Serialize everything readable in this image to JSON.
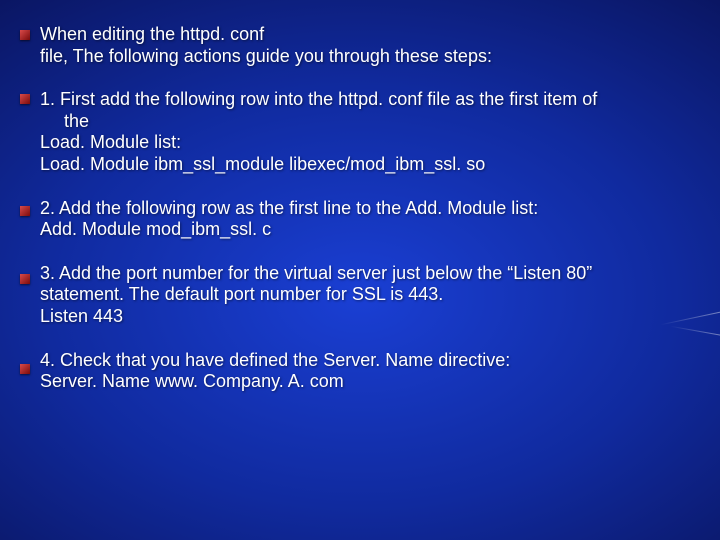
{
  "intro": {
    "line1": "When editing the httpd. conf",
    "line2": "file, The following actions guide you through these steps:"
  },
  "step1": {
    "line1": "1. First add the following row into the httpd. conf file as the first item of",
    "line2": "the",
    "line3": "Load. Module list:",
    "line4": "Load. Module ibm_ssl_module libexec/mod_ibm_ssl. so"
  },
  "step2": {
    "line1": "2. Add the following row as the first line to the Add. Module list:",
    "line2": "Add. Module mod_ibm_ssl. c"
  },
  "step3": {
    "line1": "3. Add the port number for the virtual server just below the “Listen 80”",
    "line2": "statement. The default port number for SSL is 443.",
    "line3": "Listen 443"
  },
  "step4": {
    "line1": "4. Check that you have defined the Server. Name directive:",
    "line2": "Server. Name www. Company. A. com"
  }
}
